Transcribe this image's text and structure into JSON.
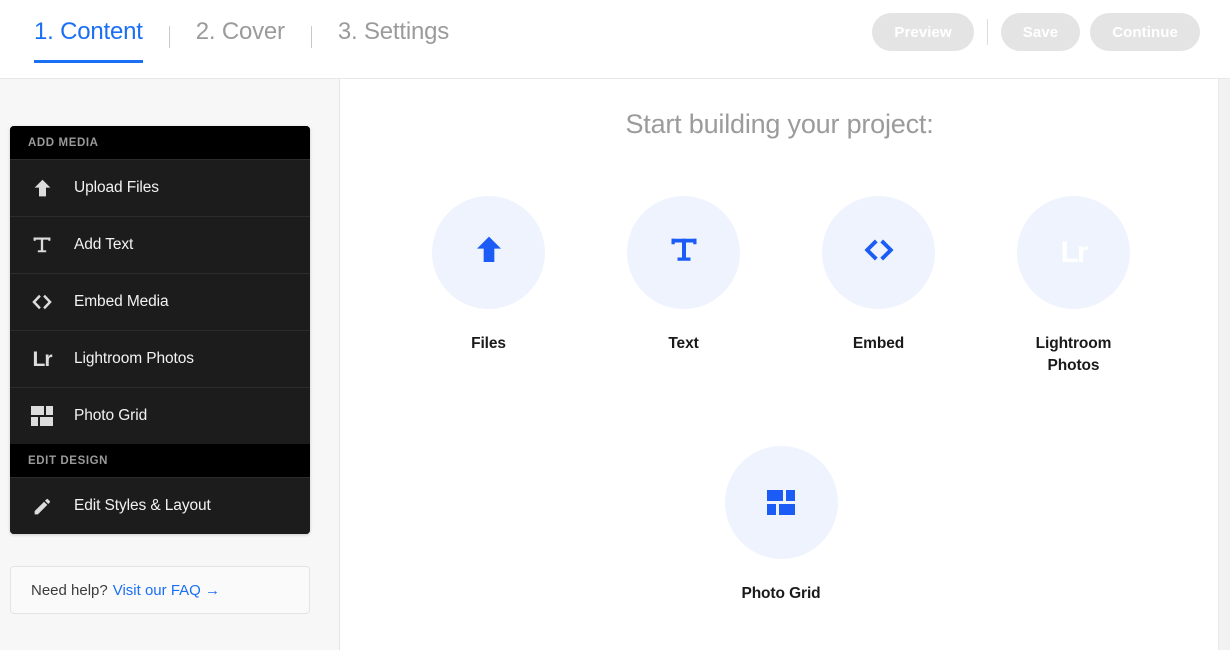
{
  "tabs": [
    {
      "label": "1. Content",
      "active": true
    },
    {
      "label": "2. Cover",
      "active": false
    },
    {
      "label": "3. Settings",
      "active": false
    }
  ],
  "actions": {
    "preview_label": "Preview",
    "save_label": "Save",
    "continue_label": "Continue"
  },
  "sidebar": {
    "sections": [
      {
        "heading": "ADD MEDIA",
        "items": [
          {
            "label": "Upload Files",
            "icon": "upload-arrow-icon"
          },
          {
            "label": "Add Text",
            "icon": "text-t-icon"
          },
          {
            "label": "Embed Media",
            "icon": "code-brackets-icon"
          },
          {
            "label": "Lightroom Photos",
            "icon": "lightroom-lr-icon"
          },
          {
            "label": "Photo Grid",
            "icon": "photo-grid-icon"
          }
        ]
      },
      {
        "heading": "EDIT DESIGN",
        "items": [
          {
            "label": "Edit Styles & Layout",
            "icon": "pencil-icon"
          }
        ]
      }
    ],
    "help": {
      "text": "Need help?",
      "link_label": "Visit our FAQ →"
    }
  },
  "main": {
    "title": "Start building your project:",
    "tiles_row1": [
      {
        "label": "Files",
        "icon": "upload-arrow-icon"
      },
      {
        "label": "Text",
        "icon": "text-t-icon"
      },
      {
        "label": "Embed",
        "icon": "code-brackets-icon"
      },
      {
        "label": "Lightroom\nPhotos",
        "icon": "lightroom-lr-icon",
        "label_line1": "Lightroom",
        "label_line2": "Photos"
      }
    ],
    "tiles_row2": [
      {
        "label": "Photo Grid",
        "icon": "photo-grid-icon"
      }
    ]
  },
  "colors": {
    "accent_blue": "#1a6ff5",
    "circle_fill": "#eef3fd",
    "sidebar_bg": "#1c1c1c",
    "sidebar_header_bg": "#000000",
    "panel_bg": "#f7f7f7",
    "disabled_button_bg": "#e4e4e4"
  }
}
